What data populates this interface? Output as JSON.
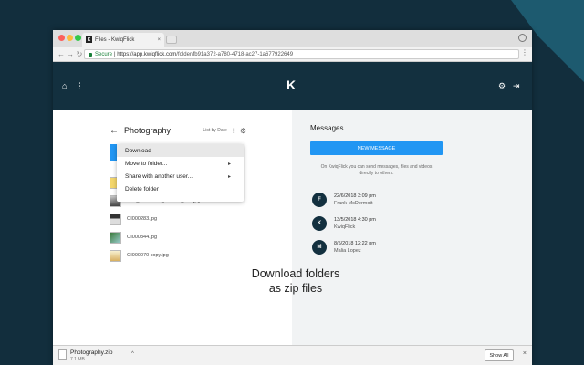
{
  "browser": {
    "tab_title": "Files - KwiqFlick",
    "tab_favicon": "K",
    "url_secure": "Secure",
    "url_host": "https://app.kwiqflick.com",
    "url_path": "/folder/fb91a372-a780-4718-ac27-1a677922649"
  },
  "app": {
    "logo": "K",
    "home_icon": "home-icon",
    "settings_icon": "gear-icon",
    "logout_icon": "logout-icon"
  },
  "folder": {
    "title": "Photography",
    "list_by": "List by Date",
    "menu": [
      {
        "label": "Download",
        "has_caret": false,
        "active": true
      },
      {
        "label": "Move to folder...",
        "has_caret": true,
        "active": false
      },
      {
        "label": "Share with another user...",
        "has_caret": true,
        "active": false
      },
      {
        "label": "Delete folder",
        "has_caret": false,
        "active": false
      }
    ],
    "files": [
      {
        "name": ""
      },
      {
        "name": "IMG_20170618_194345_404.jpg"
      },
      {
        "name": "OI000283.jpg"
      },
      {
        "name": "OI000344.jpg"
      },
      {
        "name": "OI000070 copy.jpg"
      }
    ]
  },
  "messages": {
    "title": "Messages",
    "new_button": "NEW MESSAGE",
    "info": "On KwiqFlick you can send messages, files and videos directly to others.",
    "items": [
      {
        "initial": "F",
        "date": "22/6/2018 3:09 pm",
        "from": "Frank McDermott"
      },
      {
        "initial": "K",
        "date": "13/5/2018 4:30 pm",
        "from": "KwiqFlick"
      },
      {
        "initial": "M",
        "date": "8/5/2018 12:22 pm",
        "from": "Malia Lopez"
      }
    ]
  },
  "banner": {
    "line1": "Download folders",
    "line2": "as zip files"
  },
  "downloads": {
    "file_name": "Photography.zip",
    "file_size": "7.1 MB",
    "show_all": "Show All"
  }
}
